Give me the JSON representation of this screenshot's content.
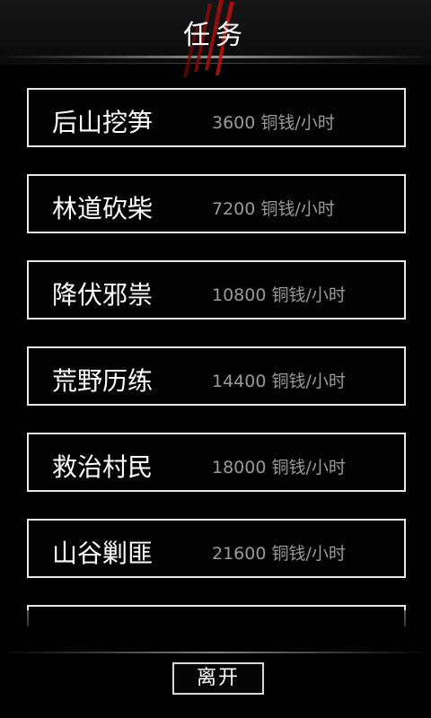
{
  "header": {
    "title": "任务"
  },
  "tasks": [
    {
      "name": "后山挖笋",
      "reward": "3600 铜钱/小时"
    },
    {
      "name": "林道砍柴",
      "reward": "7200 铜钱/小时"
    },
    {
      "name": "降伏邪祟",
      "reward": "10800 铜钱/小时"
    },
    {
      "name": "荒野历练",
      "reward": "14400 铜钱/小时"
    },
    {
      "name": "救治村民",
      "reward": "18000 铜钱/小时"
    },
    {
      "name": "山谷剿匪",
      "reward": "21600 铜钱/小时"
    }
  ],
  "footer": {
    "leave_label": "离开"
  },
  "colors": {
    "background": "#000000",
    "border": "#e8e8e8",
    "reward_text": "#9a9a9a",
    "claw_mark": "#b01010"
  },
  "icons": {
    "header_decoration": "claw-mark-icon"
  }
}
